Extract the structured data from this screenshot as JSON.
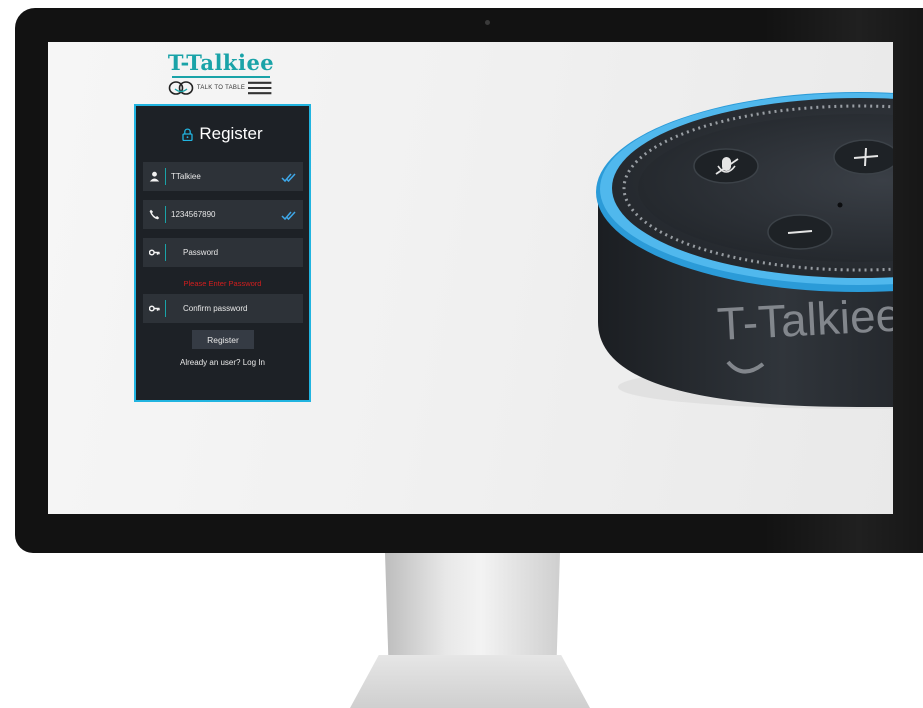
{
  "logo": {
    "title": "T-Talkiee",
    "tagline": "TALK TO TABLE"
  },
  "register_form": {
    "title": "Register",
    "fields": [
      {
        "name": "name",
        "value": "TTalkiee",
        "placeholder": "",
        "validated": true
      },
      {
        "name": "phone",
        "value": "1234567890",
        "placeholder": "",
        "validated": true
      },
      {
        "name": "password",
        "value": "",
        "placeholder": "Password",
        "validated": false
      },
      {
        "name": "confirm_password",
        "value": "",
        "placeholder": "Confirm password",
        "validated": false
      }
    ],
    "error_message": "Please Enter Password",
    "submit_label": "Register",
    "login_prompt": "Already an user? Log In"
  },
  "device": {
    "brand_text": "T-Talkiee"
  },
  "icons": {
    "name": "user-icon",
    "phone": "phone-icon",
    "password": "key-icon",
    "confirm_password": "key-icon",
    "validated": "double-check-icon",
    "title": "lock-icon"
  },
  "colors": {
    "accent": "#21b4e0",
    "brand": "#1aa3a8",
    "card_bg": "#1d2126",
    "field_bg": "#2d3238",
    "error": "#d21e1e",
    "check": "#3ea7e8"
  }
}
